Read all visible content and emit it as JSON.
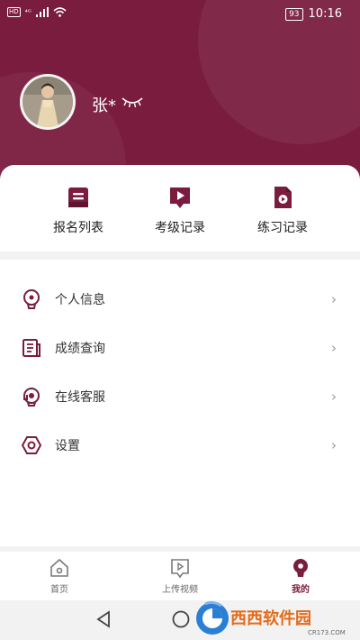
{
  "status_bar": {
    "hd": "HD",
    "signal": "⁴ᴳ",
    "battery": "93",
    "time": "10:16"
  },
  "profile": {
    "username": "张*",
    "avatar_icon": "avatar-photo"
  },
  "shortcuts": [
    {
      "label": "报名列表",
      "icon": "registration-list-icon"
    },
    {
      "label": "考级记录",
      "icon": "exam-record-icon"
    },
    {
      "label": "练习记录",
      "icon": "practice-record-icon"
    }
  ],
  "menu": [
    {
      "label": "个人信息",
      "icon": "personal-info-icon"
    },
    {
      "label": "成绩查询",
      "icon": "score-query-icon"
    },
    {
      "label": "在线客服",
      "icon": "customer-service-icon"
    },
    {
      "label": "设置",
      "icon": "settings-icon"
    }
  ],
  "tab_bar": {
    "tabs": [
      {
        "label": "首页",
        "icon": "home-icon"
      },
      {
        "label": "上传视频",
        "icon": "upload-video-icon"
      },
      {
        "label": "我的",
        "icon": "profile-icon"
      }
    ],
    "active": "我的"
  },
  "watermark": {
    "brand": "西西软件园",
    "url": "CR173.COM"
  },
  "colors": {
    "accent": "#7a1c3e",
    "background": "#f2f2f2"
  }
}
